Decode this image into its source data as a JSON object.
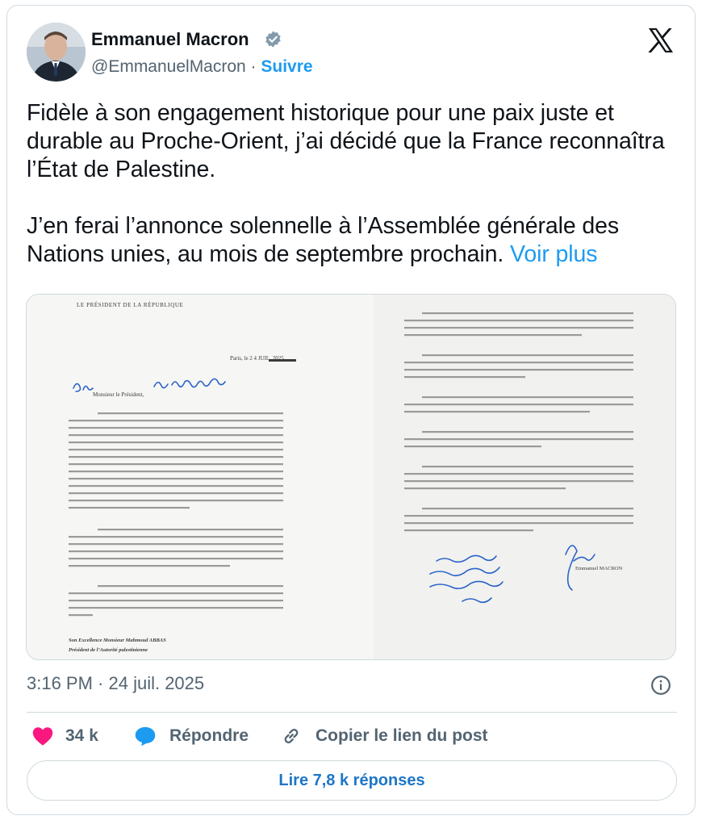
{
  "author": {
    "name": "Emmanuel Macron",
    "handle": "@EmmanuelMacron",
    "separator": " · ",
    "follow_label": "Suivre"
  },
  "tweet": {
    "paragraph_1": "Fidèle à son engagement historique pour une paix juste et durable au Proche-Orient, j’ai décidé que la France reconnaîtra l’État de Palestine.",
    "paragraph_2": "J’en ferai l’annonce solennelle à l’Assemblée générale des Nations unies, au mois de septembre prochain.",
    "more_label": "Voir plus"
  },
  "media": {
    "letter_header": "LE PRÉSIDENT DE LA RÉPUBLIQUE",
    "letter_date": "Paris, le       2 4 JUIL. 2025",
    "letter_greeting": "Monsieur le Président,",
    "letter_recipient": "Son Excellence Monsieur Mahmoud ABBAS",
    "letter_recipient_title": "Président de l’Autorité palestinienne",
    "letter_signature": "Emmanuel MACRON"
  },
  "meta": {
    "timestamp": "3:16 PM · 24 juil. 2025"
  },
  "actions": {
    "likes": "34 k",
    "reply_label": "Répondre",
    "copy_label": "Copier le lien du post",
    "replies_button": "Lire 7,8 k réponses"
  },
  "colors": {
    "accent": "#1d9bf0",
    "like": "#f91880",
    "reply": "#1d9bf0",
    "text_secondary": "#536471",
    "border": "#cfd9de"
  },
  "icons": {
    "verified": "verified-badge-icon",
    "logo": "x-logo-icon",
    "info": "info-icon",
    "like": "heart-icon",
    "reply": "speech-bubble-icon",
    "copy": "link-icon"
  }
}
